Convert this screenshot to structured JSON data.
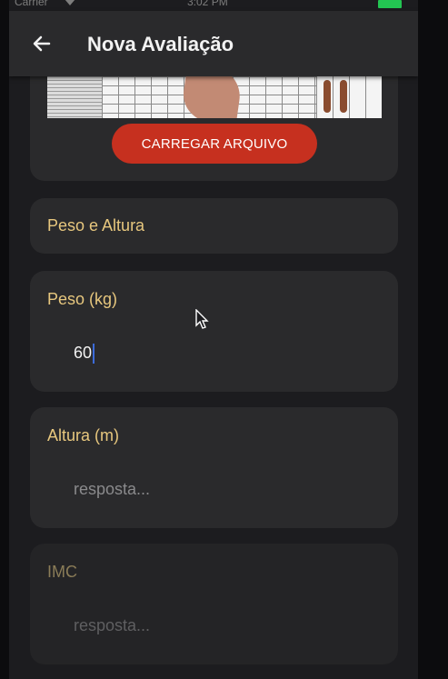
{
  "status_bar": {
    "carrier": "Carrier",
    "time": "3:02 PM"
  },
  "app_bar": {
    "title": "Nova Avaliação",
    "back_icon": "arrow-left-icon"
  },
  "file_upload": {
    "button_label": "CARREGAR ARQUIVO"
  },
  "section": {
    "title": "Peso e Altura"
  },
  "fields": [
    {
      "label": "Peso (kg)",
      "value": "60",
      "placeholder": ""
    },
    {
      "label": "Altura (m)",
      "value": "",
      "placeholder": "resposta..."
    },
    {
      "label": "IMC",
      "value": "",
      "placeholder": "resposta..."
    }
  ],
  "colors": {
    "background": "#1c1c1f",
    "card": "#2a2a2c",
    "label": "#e7c77e",
    "button": "#c6301f"
  }
}
